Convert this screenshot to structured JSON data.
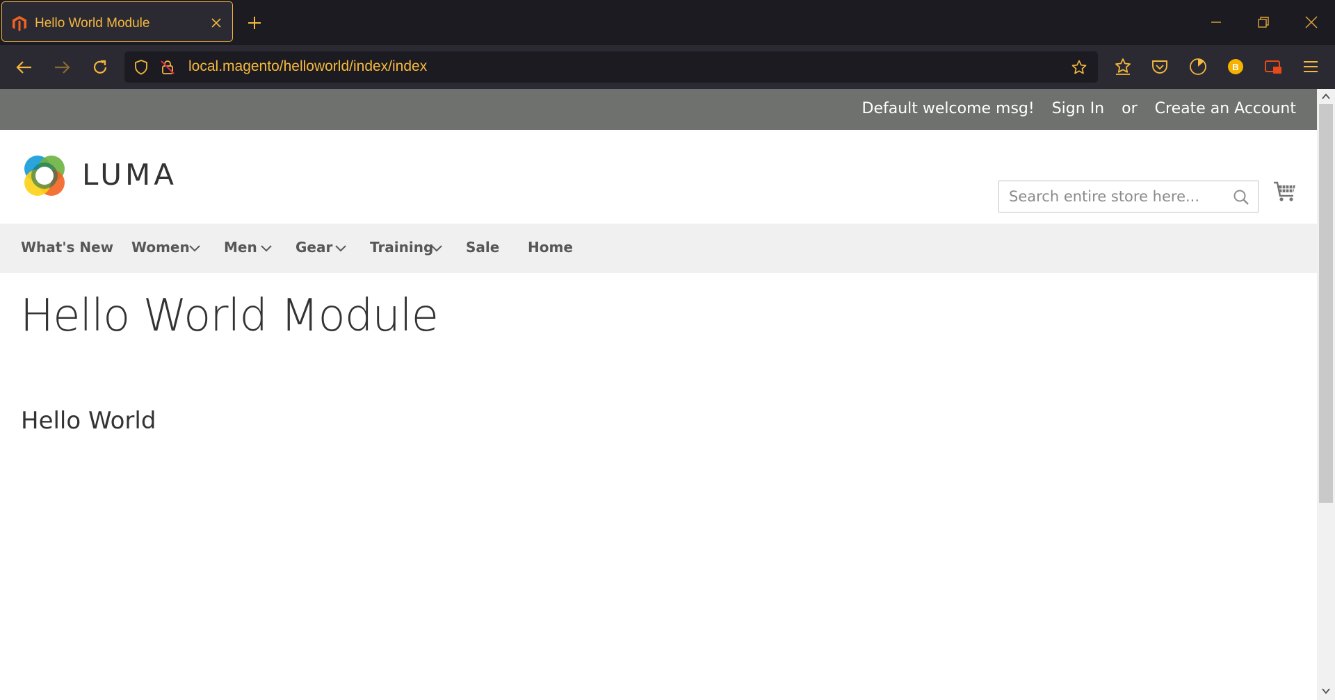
{
  "browser": {
    "tab": {
      "title": "Hello World Module"
    },
    "url": "local.magento/helloworld/index/index",
    "colors": {
      "accent": "#f5b83d",
      "chrome_dark": "#1c1b22",
      "chrome": "#2b2a33"
    }
  },
  "page": {
    "header": {
      "welcome": "Default welcome msg!",
      "sign_in": "Sign In",
      "or": "or",
      "create_account": "Create an Account"
    },
    "logo_text": "LUMA",
    "search": {
      "placeholder": "Search entire store here..."
    },
    "nav": {
      "items": [
        {
          "label": "What's New"
        },
        {
          "label": "Women"
        },
        {
          "label": "Men"
        },
        {
          "label": "Gear"
        },
        {
          "label": "Training"
        },
        {
          "label": "Sale"
        },
        {
          "label": "Home"
        }
      ]
    },
    "title": "Hello World Module",
    "content": "Hello World",
    "colors": {
      "panel_header": "#6e716e",
      "nav_bg": "#f0f0f0",
      "text": "#333333"
    }
  }
}
